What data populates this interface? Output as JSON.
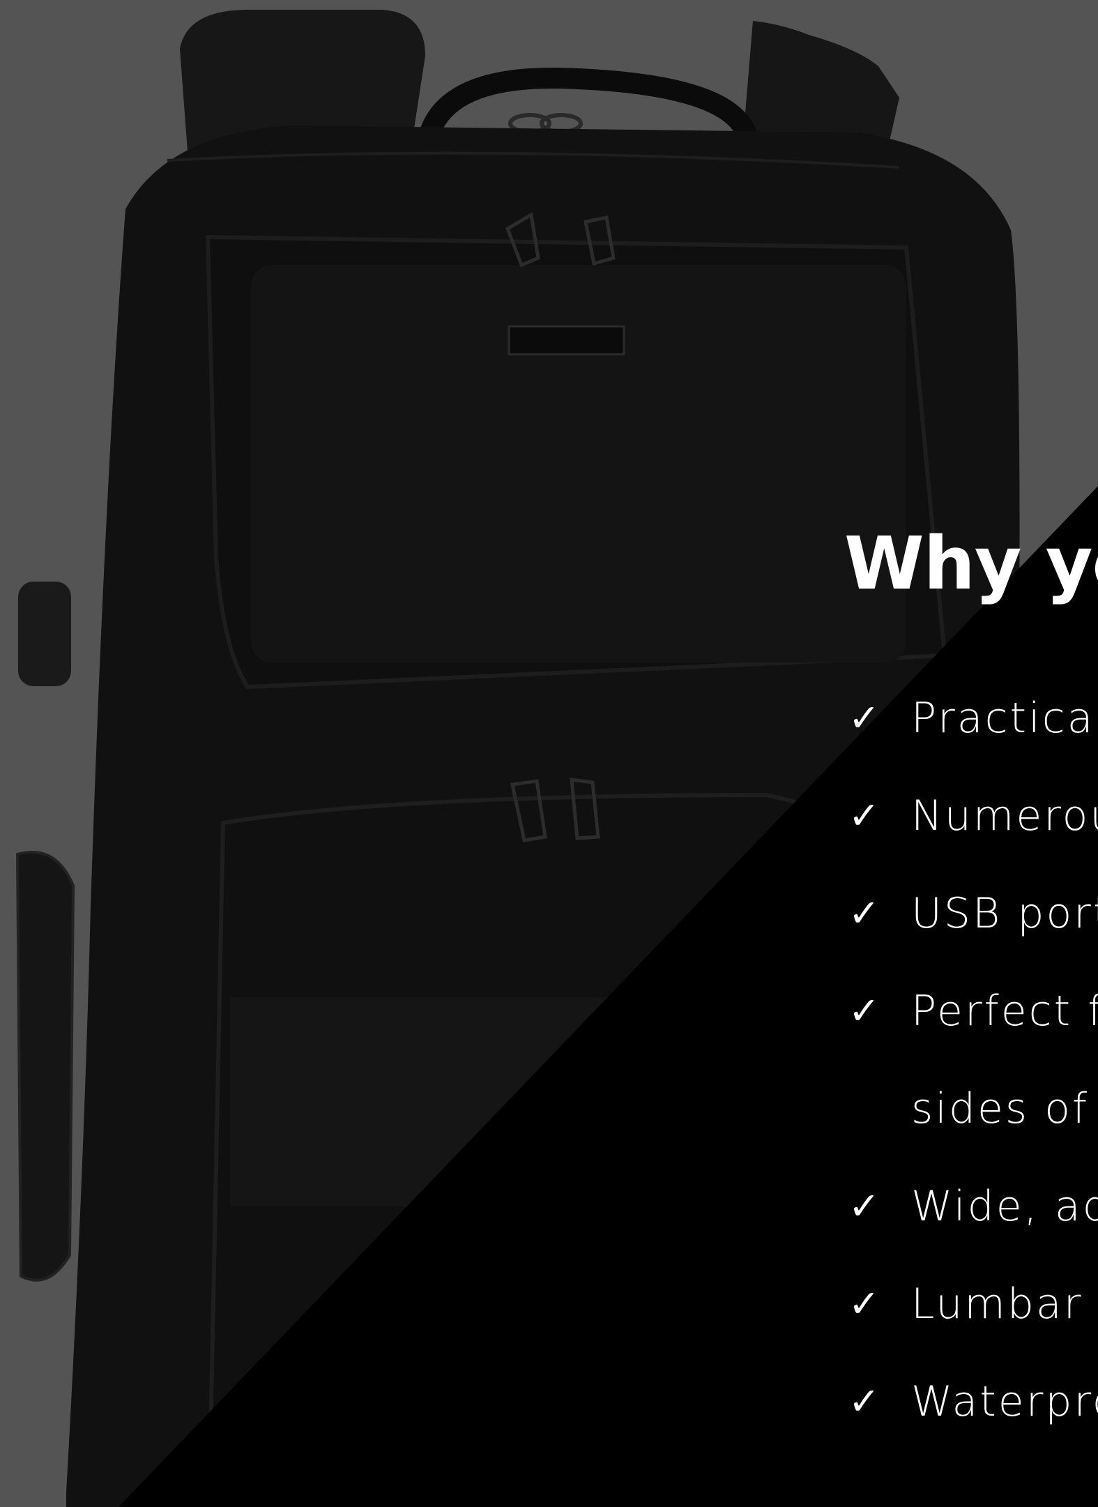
{
  "colors": {
    "background": "#545454",
    "backpack": "#111111",
    "overlay": "#000000",
    "text": "#ffffff"
  },
  "product_image": {
    "subject": "black laptop backpack",
    "icon": "backpack-photo"
  },
  "heading": "Why yo",
  "features": [
    {
      "icon": "checkmark",
      "check": "✓",
      "text": "Practical"
    },
    {
      "icon": "checkmark",
      "check": "✓",
      "text": "Numerou"
    },
    {
      "icon": "checkmark",
      "check": "✓",
      "text": "USB port"
    },
    {
      "icon": "checkmark",
      "check": "✓",
      "text": "Perfect fo",
      "text_line2": "sides of th"
    },
    {
      "icon": "checkmark",
      "check": "✓",
      "text": "Wide, adj"
    },
    {
      "icon": "checkmark",
      "check": "✓",
      "text": "Lumbar p"
    },
    {
      "icon": "checkmark",
      "check": "✓",
      "text": "Waterpro"
    }
  ]
}
